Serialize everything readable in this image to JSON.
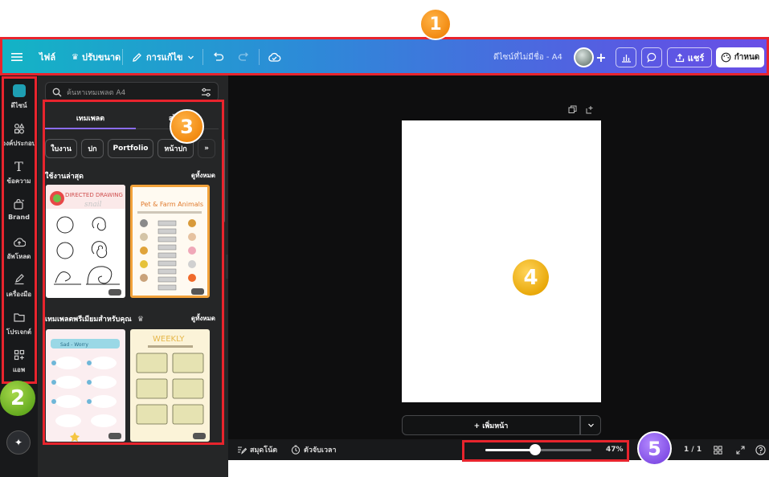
{
  "toolbar": {
    "file_label": "ไฟล์",
    "resize_label": "ปรับขนาด",
    "editing_label": "การแก้ไข",
    "design_title": "ดีไซน์ที่ไม่มีชื่อ - A4",
    "share_label": "แชร์",
    "draw_label": "กำหนด"
  },
  "rail": {
    "items": [
      {
        "label": "ดีไซน์",
        "icon": "design-icon"
      },
      {
        "label": "องค์ประกอบ",
        "icon": "elements-icon"
      },
      {
        "label": "ข้อความ",
        "icon": "text-icon"
      },
      {
        "label": "Brand",
        "icon": "brand-icon"
      },
      {
        "label": "อัพโหลด",
        "icon": "upload-icon"
      },
      {
        "label": "เครื่องมือ",
        "icon": "tools-icon"
      },
      {
        "label": "โปรเจกต์",
        "icon": "folder-icon"
      },
      {
        "label": "แอพ",
        "icon": "apps-icon"
      }
    ]
  },
  "panel": {
    "search_placeholder": "ค้นหาเทมเพลต A4",
    "tab_templates": "เทมเพลต",
    "tab_other": "สไ",
    "chips": [
      "ใบงาน",
      "ปก",
      "Portfolio",
      "หน้าปก"
    ],
    "recent_title": "ใช้งานล่าสุด",
    "recent_see_all": "ดูทั้งหมด",
    "premium_title": "เทมเพลตพรีเมียมสำหรับคุณ",
    "premium_see_all": "ดูทั้งหมด",
    "thumb1_title": "DIRECTED DRAWING",
    "thumb1_subtitle": "snail",
    "thumb2_title": "Pet & Farm Animals",
    "thumb3_title": "Sad - Worry",
    "thumb4_title": "WEEKLY"
  },
  "canvas": {
    "add_page_label": "+ เพิ่มหน้า"
  },
  "bottombar": {
    "notes_label": "สมุดโน้ต",
    "timer_label": "ตัวจับเวลา",
    "zoom_label": "47%",
    "zoom_value": 0.47,
    "page_counter": "1 / 1"
  },
  "annotations": [
    "1",
    "2",
    "3",
    "4",
    "5"
  ],
  "colors": {
    "accent_purple": "#8b6cf0",
    "highlight_red": "#e8242d",
    "teal": "#13b4c5"
  }
}
